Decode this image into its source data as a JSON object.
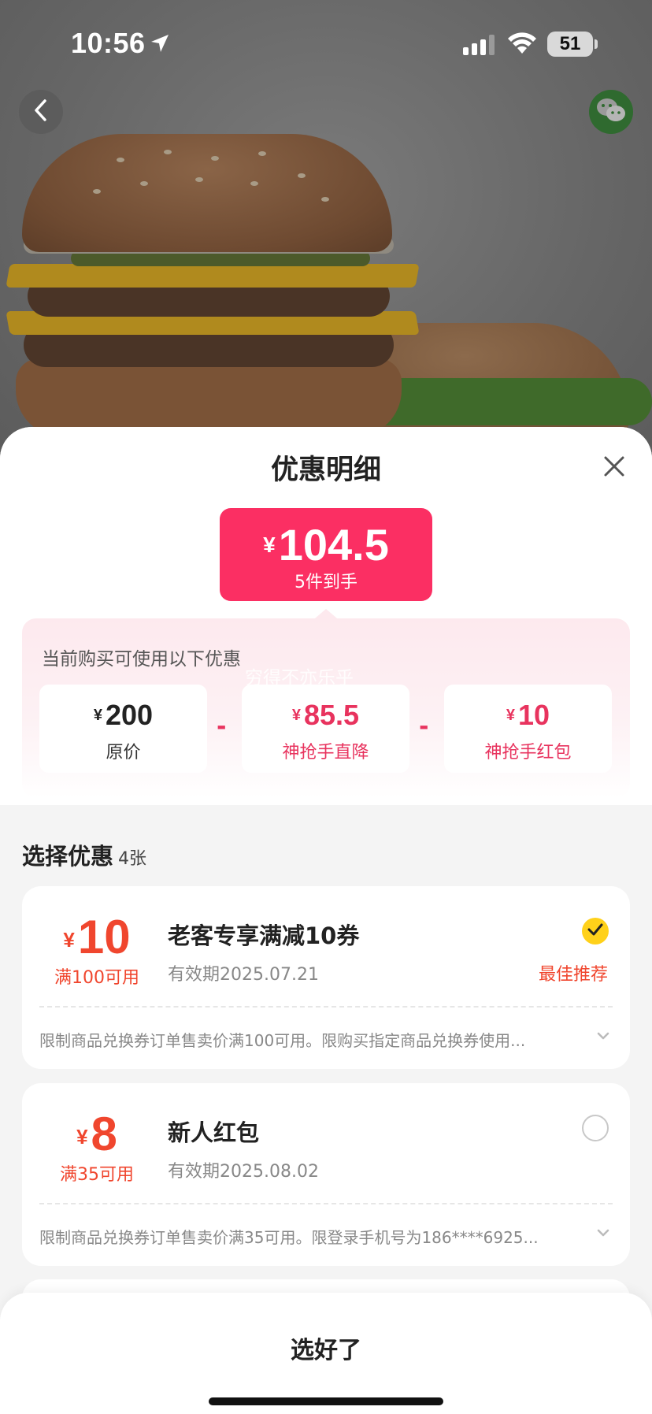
{
  "status_bar": {
    "time": "10:56",
    "battery": "51"
  },
  "sheet": {
    "title": "优惠明细",
    "final_price": {
      "currency": "¥",
      "amount": "104.5",
      "subtitle": "5件到手"
    },
    "detail": {
      "label": "当前购买可使用以下优惠",
      "watermark": "穷得不亦乐乎",
      "items": [
        {
          "currency": "¥",
          "value": "200",
          "label": "原价"
        },
        {
          "currency": "¥",
          "value": "85.5",
          "label": "神抢手直降"
        },
        {
          "currency": "¥",
          "value": "10",
          "label": "神抢手红包"
        }
      ],
      "operator": "-"
    },
    "select": {
      "title": "选择优惠",
      "count": "4张"
    },
    "coupons": [
      {
        "currency": "¥",
        "amount": "10",
        "condition": "满100可用",
        "name": "老客专享满减10券",
        "validity": "有效期2025.07.21",
        "selected": true,
        "badge": "最佳推荐",
        "description": "限制商品兑换券订单售卖价满100可用。限购买指定商品兑换券使用..."
      },
      {
        "currency": "¥",
        "amount": "8",
        "condition": "满35可用",
        "name": "新人红包",
        "validity": "有效期2025.08.02",
        "selected": false,
        "badge": "",
        "description": "限制商品兑换券订单售卖价满35可用。限登录手机号为186****6925..."
      }
    ],
    "confirm_label": "选好了"
  },
  "colors": {
    "accent_pink": "#fb2f63",
    "coupon_red": "#f0462e",
    "check_yellow": "#ffd11a"
  }
}
